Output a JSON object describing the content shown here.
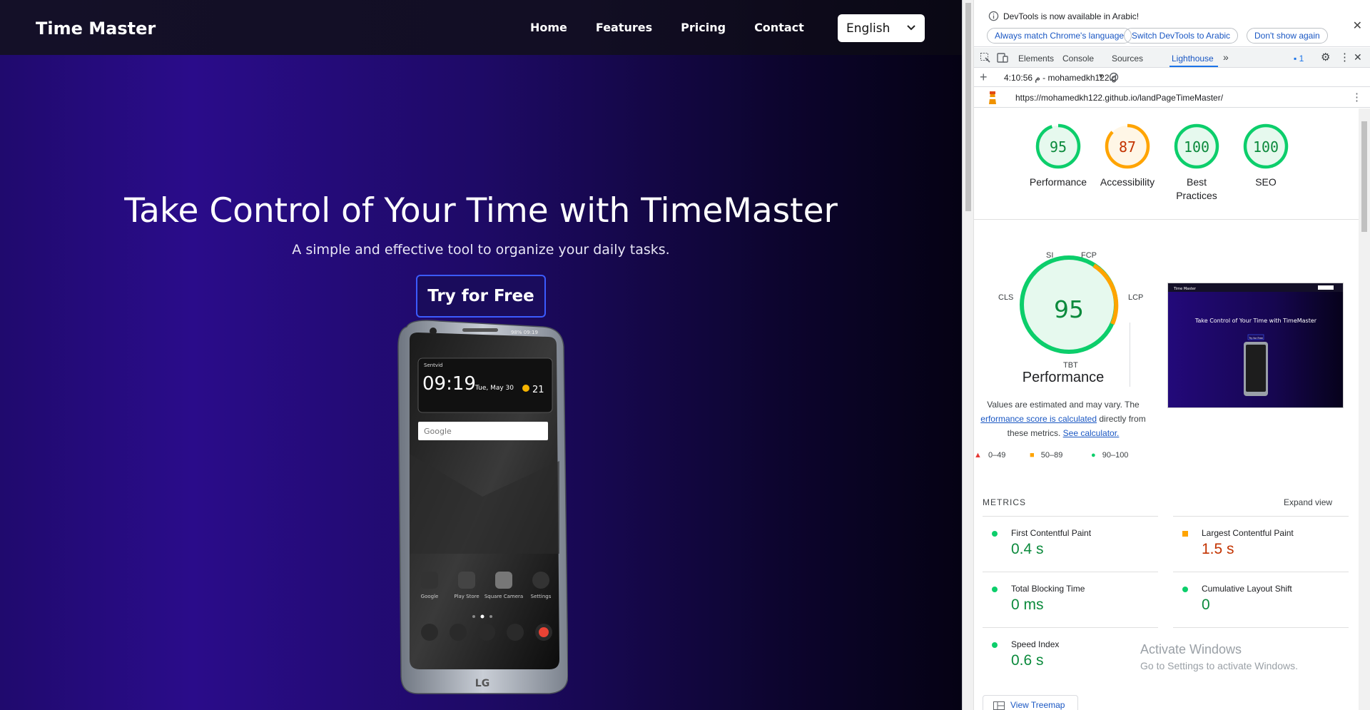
{
  "site": {
    "brand": "Time Master",
    "nav": [
      "Home",
      "Features",
      "Pricing",
      "Contact"
    ],
    "language": "English",
    "hero_title": "Take Control of Your Time with TimeMaster",
    "hero_subtitle": "A simple and effective tool to organize your daily tasks.",
    "cta": "Try for Free",
    "phone": {
      "status": "98%  09:19",
      "time": "09:19",
      "date": "Tue, May 30",
      "temp": "21",
      "location": "Sentvid",
      "search_brand": "Google",
      "apps": [
        "Google",
        "Play Store",
        "Square Camera",
        "Settings"
      ],
      "maker": "LG"
    }
  },
  "devtools": {
    "info_text": "DevTools is now available in Arabic!",
    "pills": [
      "Always match Chrome's language",
      "Switch DevTools to Arabic",
      "Don't show again"
    ],
    "tabs": [
      "Elements",
      "Console",
      "Sources",
      "Lighthouse"
    ],
    "badge_count": "1",
    "report_time": "4:10:56 م - mohamedkh122.g",
    "url": "https://mohamedkh122.github.io/landPageTimeMaster/",
    "scores": [
      {
        "label": "Performance",
        "value": "95",
        "color": "#0cce6b",
        "text_color": "#0b8a3c"
      },
      {
        "label": "Accessibility",
        "value": "87",
        "color": "#ffa400",
        "text_color": "#c33300"
      },
      {
        "label": "Best Practices",
        "value": "100",
        "color": "#0cce6b",
        "text_color": "#0b8a3c"
      },
      {
        "label": "SEO",
        "value": "100",
        "color": "#0cce6b",
        "text_color": "#0b8a3c"
      }
    ],
    "perf_score": "95",
    "perf_title": "Performance",
    "perf_desc_1": "Values are estimated and may vary. The",
    "perf_desc_link": "erformance score is calculated",
    "perf_desc_2": "directly from these metrics.",
    "perf_desc_link2": "See calculator.",
    "gauge_labels": [
      "SI",
      "FCP",
      "LCP",
      "TBT",
      "CLS"
    ],
    "legend": [
      "0–49",
      "50–89",
      "90–100"
    ],
    "metrics_heading": "METRICS",
    "expand_view": "Expand view",
    "metrics": [
      {
        "name": "First Contentful Paint",
        "value": "0.4 s",
        "status": "good"
      },
      {
        "name": "Largest Contentful Paint",
        "value": "1.5 s",
        "status": "average"
      },
      {
        "name": "Total Blocking Time",
        "value": "0 ms",
        "status": "good"
      },
      {
        "name": "Cumulative Layout Shift",
        "value": "0",
        "status": "good"
      },
      {
        "name": "Speed Index",
        "value": "0.6 s",
        "status": "good"
      }
    ],
    "view_treemap": "View Treemap",
    "thumb": {
      "brand": "Time Master",
      "title": "Take Control of Your Time with TimeMaster",
      "cta": "Try for Free"
    }
  },
  "watermark": {
    "line1": "Activate Windows",
    "line2": "Go to Settings to activate Windows."
  }
}
